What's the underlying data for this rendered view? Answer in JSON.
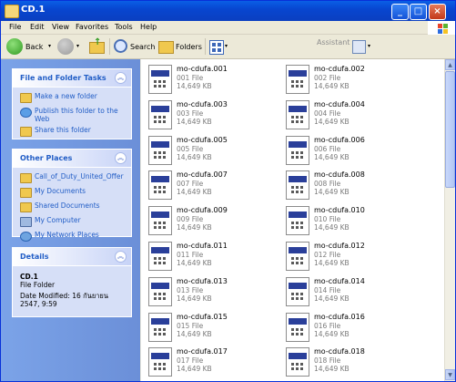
{
  "window": {
    "title": "CD.1"
  },
  "menu": [
    "File",
    "Edit",
    "View",
    "Favorites",
    "Tools",
    "Help"
  ],
  "toolbar": {
    "back": "Back",
    "search": "Search",
    "folders": "Folders",
    "assistant": "Assistant"
  },
  "tasks": {
    "title": "File and Folder Tasks",
    "items": [
      "Make a new folder",
      "Publish this folder to the Web",
      "Share this folder"
    ]
  },
  "places": {
    "title": "Other Places",
    "items": [
      "Call_of_Duty_United_Offer",
      "My Documents",
      "Shared Documents",
      "My Computer",
      "My Network Places"
    ]
  },
  "details": {
    "title": "Details",
    "name": "CD.1",
    "type": "File Folder",
    "modified": "Date Modified: 16 กันยายน 2547, 9:59"
  },
  "files": [
    {
      "name": "mo-cdufa.001",
      "type": "001 File",
      "size": "14,649 KB"
    },
    {
      "name": "mo-cdufa.002",
      "type": "002 File",
      "size": "14,649 KB"
    },
    {
      "name": "mo-cdufa.003",
      "type": "003 File",
      "size": "14,649 KB"
    },
    {
      "name": "mo-cdufa.004",
      "type": "004 File",
      "size": "14,649 KB"
    },
    {
      "name": "mo-cdufa.005",
      "type": "005 File",
      "size": "14,649 KB"
    },
    {
      "name": "mo-cdufa.006",
      "type": "006 File",
      "size": "14,649 KB"
    },
    {
      "name": "mo-cdufa.007",
      "type": "007 File",
      "size": "14,649 KB"
    },
    {
      "name": "mo-cdufa.008",
      "type": "008 File",
      "size": "14,649 KB"
    },
    {
      "name": "mo-cdufa.009",
      "type": "009 File",
      "size": "14,649 KB"
    },
    {
      "name": "mo-cdufa.010",
      "type": "010 File",
      "size": "14,649 KB"
    },
    {
      "name": "mo-cdufa.011",
      "type": "011 File",
      "size": "14,649 KB"
    },
    {
      "name": "mo-cdufa.012",
      "type": "012 File",
      "size": "14,649 KB"
    },
    {
      "name": "mo-cdufa.013",
      "type": "013 File",
      "size": "14,649 KB"
    },
    {
      "name": "mo-cdufa.014",
      "type": "014 File",
      "size": "14,649 KB"
    },
    {
      "name": "mo-cdufa.015",
      "type": "015 File",
      "size": "14,649 KB"
    },
    {
      "name": "mo-cdufa.016",
      "type": "016 File",
      "size": "14,649 KB"
    },
    {
      "name": "mo-cdufa.017",
      "type": "017 File",
      "size": "14,649 KB"
    },
    {
      "name": "mo-cdufa.018",
      "type": "018 File",
      "size": "14,649 KB"
    }
  ]
}
